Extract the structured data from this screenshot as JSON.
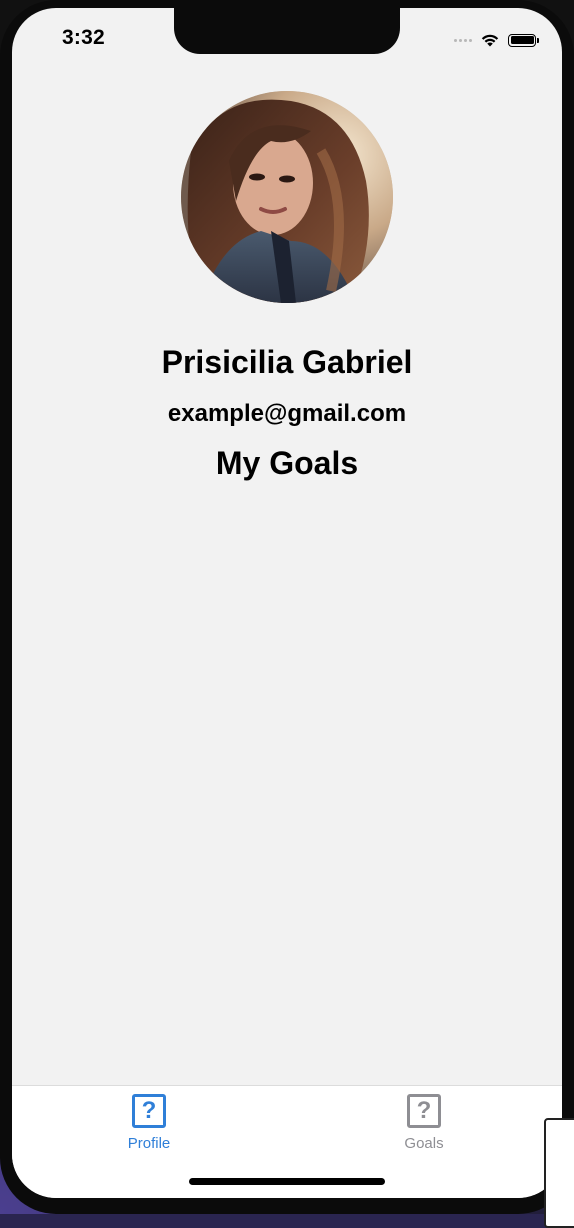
{
  "status_bar": {
    "time": "3:32"
  },
  "profile": {
    "avatar_alt": "Profile photo",
    "name": "Prisicilia Gabriel",
    "email": "example@gmail.com"
  },
  "section": {
    "title": "My Goals"
  },
  "tab_bar": {
    "tabs": [
      {
        "label": "Profile",
        "icon": "question-square-icon",
        "active": true,
        "color": "#2f7fd8"
      },
      {
        "label": "Goals",
        "icon": "question-square-icon",
        "active": false,
        "color": "#8e8e93"
      }
    ]
  },
  "colors": {
    "background": "#f2f2f2",
    "accent": "#2f7fd8",
    "inactive": "#8e8e93"
  }
}
